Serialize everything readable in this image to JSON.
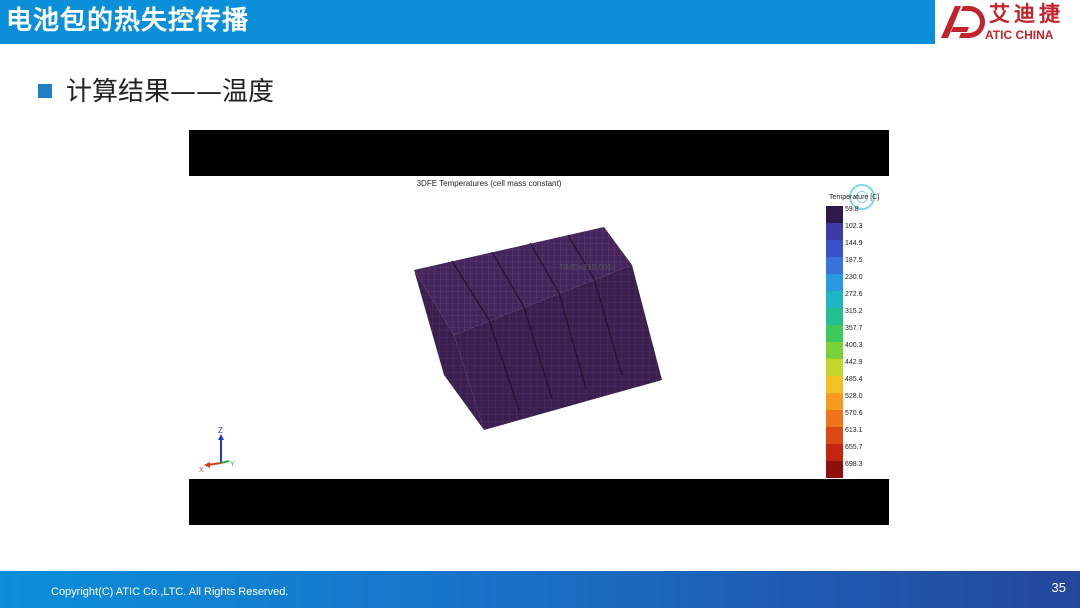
{
  "header": {
    "title": "电池包的热失控传播",
    "logo_cn": "艾迪捷",
    "logo_en": "ATIC CHINA",
    "color": "#0b8fd8"
  },
  "content": {
    "subtitle": "计算结果——温度"
  },
  "figure": {
    "sim_title": "3DFE Temperatures (cell mass constant)",
    "overlay_text": "TIME=310.001s",
    "legend": {
      "title": "Temperature [C]",
      "entries": [
        {
          "value": "59.8",
          "color": "#2d1a4a"
        },
        {
          "value": "102.3",
          "color": "#3f3ba6"
        },
        {
          "value": "144.9",
          "color": "#3a52c9"
        },
        {
          "value": "187.5",
          "color": "#3a72dc"
        },
        {
          "value": "230.0",
          "color": "#2a9ae0"
        },
        {
          "value": "272.6",
          "color": "#1fb6c4"
        },
        {
          "value": "315.2",
          "color": "#23c08f"
        },
        {
          "value": "357.7",
          "color": "#3dc95a"
        },
        {
          "value": "400.3",
          "color": "#79d23a"
        },
        {
          "value": "442.9",
          "color": "#c2d62c"
        },
        {
          "value": "485.4",
          "color": "#f2c126"
        },
        {
          "value": "528.0",
          "color": "#f79b1f"
        },
        {
          "value": "570.6",
          "color": "#f0741a"
        },
        {
          "value": "613.1",
          "color": "#db4a14"
        },
        {
          "value": "655.7",
          "color": "#c3250e"
        },
        {
          "value": "698.3",
          "color": "#8e0f0b"
        }
      ]
    },
    "axes": {
      "z": "Z",
      "y": "Y",
      "x": "X"
    }
  },
  "footer": {
    "copyright": "Copyright(C) ATIC Co.,LTC. All Rights Reserved.",
    "page_number": "35"
  }
}
